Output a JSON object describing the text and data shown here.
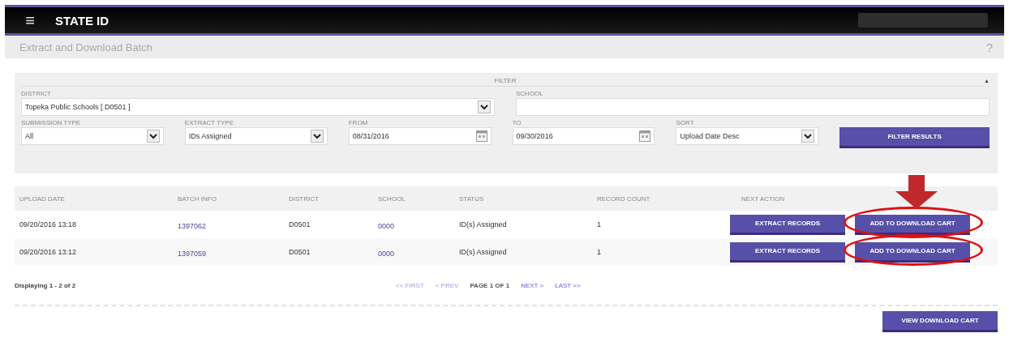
{
  "app_bar": {
    "menu_icon": "≡",
    "title": "STATE ID"
  },
  "page": {
    "title": "Extract and Download Batch",
    "help": "?"
  },
  "filter": {
    "title": "FILTER",
    "collapse": "▲",
    "fields": [
      {
        "kind": "select",
        "label": "DISTRICT",
        "value": "Topeka Public Schools [ D0501 ]"
      },
      {
        "kind": "text",
        "label": "SCHOOL"
      },
      {
        "kind": "select",
        "label": "SUBMISSION TYPE",
        "value": "All"
      },
      {
        "kind": "select",
        "label": "EXTRACT TYPE",
        "value": "IDs Assigned"
      },
      {
        "kind": "date",
        "label": "FROM",
        "value": "08/31/2016"
      },
      {
        "kind": "date",
        "label": "TO",
        "value": "09/30/2016"
      },
      {
        "kind": "select",
        "label": "SORT",
        "value": "Upload Date Desc"
      }
    ],
    "button": "FILTER RESULTS"
  },
  "table": {
    "columns": [
      "UPLOAD DATE",
      "BATCH INFO",
      "DISTRICT",
      "SCHOOL",
      "STATUS",
      "RECORD COUNT",
      "NEXT ACTION"
    ],
    "rows": [
      {
        "upload_date": "09/20/2016 13:18",
        "batch_info": "1397062",
        "district": "D0501",
        "school": "0000",
        "status": "ID(s) Assigned",
        "record_count": "1",
        "actions": [
          "EXTRACT RECORDS",
          "ADD TO DOWNLOAD CART"
        ],
        "highlighted": true
      },
      {
        "upload_date": "09/20/2016 13:12",
        "batch_info": "1397059",
        "district": "D0501",
        "school": "0000",
        "status": "ID(s) Assigned",
        "record_count": "1",
        "actions": [
          "EXTRACT RECORDS",
          "ADD TO DOWNLOAD CART"
        ],
        "highlighted": true
      }
    ]
  },
  "pagination": {
    "summary": "Displaying 1 - 2 of 2",
    "links": [
      {
        "kind": "link",
        "label": "<< FIRST",
        "disabled": true
      },
      {
        "kind": "link",
        "label": "< PREV",
        "disabled": true
      },
      {
        "kind": "text",
        "label": "PAGE 1 OF 1"
      },
      {
        "kind": "link",
        "label": "NEXT >",
        "disabled": false
      },
      {
        "kind": "link",
        "label": "LAST >>",
        "disabled": false
      }
    ]
  },
  "footer": {
    "button": "VIEW DOWNLOAD CART"
  }
}
